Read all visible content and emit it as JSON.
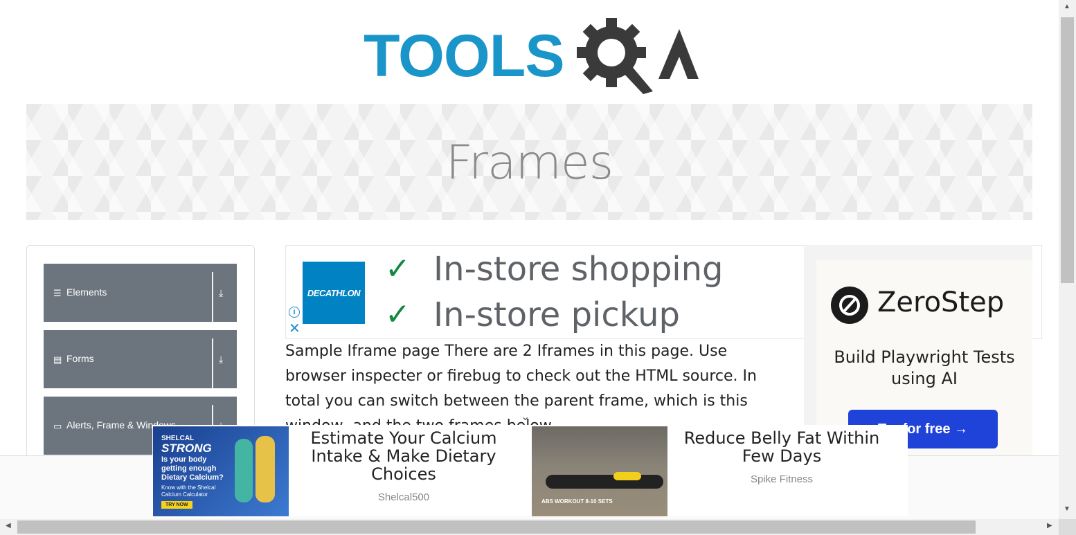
{
  "header": {
    "logo_text": "TOOLS",
    "logo_suffix": "A"
  },
  "banner": {
    "title": "Frames"
  },
  "sidebar": {
    "items": [
      {
        "label": "Elements",
        "icon": "list-icon"
      },
      {
        "label": "Forms",
        "icon": "doc-icon"
      },
      {
        "label": "Alerts, Frame & Windows",
        "icon": "window-icon"
      }
    ]
  },
  "ad_top": {
    "brand": "DECATHLON",
    "lines": [
      "In-store shopping",
      "In-store pickup"
    ]
  },
  "ad_right": {
    "brand": "ZeroStep",
    "tagline": "Build Playwright Tests using AI",
    "cta": "Try for free →"
  },
  "content": {
    "text": "Sample Iframe page There are 2 Iframes in this page. Use browser inspecter or firebug to check out the HTML source. In total you can switch between the parent frame, which is this window, and the two frames below"
  },
  "bottom_ads": [
    {
      "headline": "Estimate Your Calcium Intake & Make Dietary Choices",
      "source": "Shelcal500",
      "image_text": {
        "brand_small": "SHELCAL",
        "brand": "STRONG",
        "question": "Is your body getting enough Dietary Calcium?",
        "subtext": "Know with the Shelcal Calcium Calculator",
        "button": "TRY NOW"
      }
    },
    {
      "headline": "Reduce Belly Fat Within Few Days",
      "source": "Spike Fitness",
      "image_text": {
        "caption": "ABS WORKOUT 8-10 SETS"
      }
    }
  ],
  "colors": {
    "logo_blue": "#1995c9",
    "logo_dark": "#3a3a3a",
    "nav_bg": "#6c757d",
    "cta_blue": "#1f43d8",
    "check_green": "#118a3d"
  }
}
